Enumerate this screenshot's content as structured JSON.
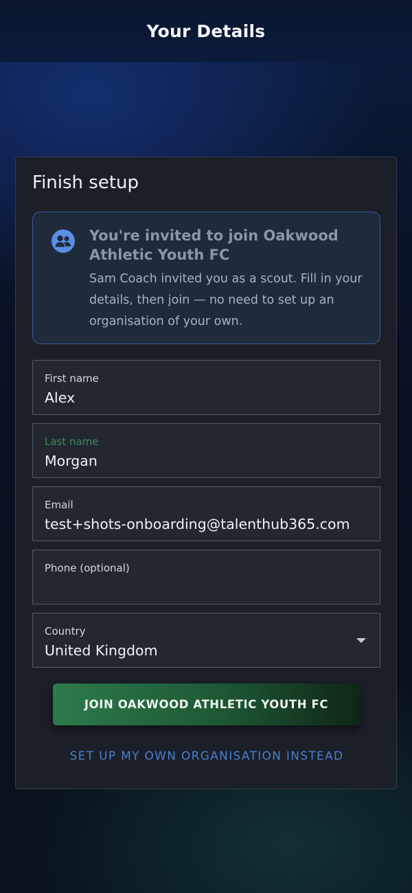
{
  "header": {
    "title": "Your Details"
  },
  "card": {
    "title": "Finish setup",
    "invite": {
      "title": "You're invited to join Oakwood Athletic Youth FC",
      "body": "Sam Coach invited you as a scout. Fill in your details, then join — no need to set up an organisation of your own.",
      "icon": "group-icon"
    },
    "fields": {
      "first_name": {
        "label": "First name",
        "value": "Alex"
      },
      "last_name": {
        "label": "Last name",
        "value": "Morgan"
      },
      "email": {
        "label": "Email",
        "value": "test+shots-onboarding@talenthub365.com"
      },
      "phone": {
        "label": "Phone (optional)",
        "value": ""
      },
      "country": {
        "label": "Country",
        "value": "United Kingdom"
      }
    },
    "join_button": "JOIN OAKWOOD ATHLETIC YOUTH FC",
    "own_org_link": "SET UP MY OWN ORGANISATION INSTEAD"
  },
  "colors": {
    "accent_green": "#2e7a4b",
    "link_blue": "#4a7fd0",
    "invite_border": "#3a5d98"
  }
}
